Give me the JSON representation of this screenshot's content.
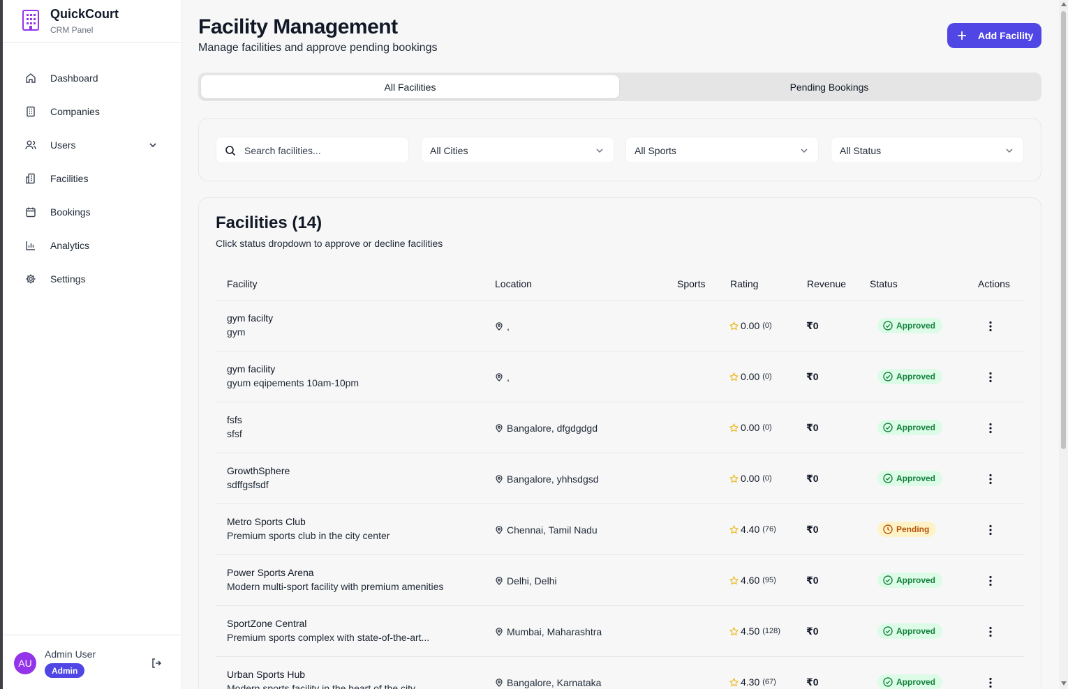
{
  "brand": {
    "name": "QuickCourt",
    "subtitle": "CRM Panel",
    "accent": "#9333ea"
  },
  "sidebar": {
    "items": [
      {
        "label": "Dashboard",
        "icon": "home-icon"
      },
      {
        "label": "Companies",
        "icon": "building-icon"
      },
      {
        "label": "Users",
        "icon": "users-icon",
        "expandable": true
      },
      {
        "label": "Facilities",
        "icon": "facility-icon"
      },
      {
        "label": "Bookings",
        "icon": "calendar-icon"
      },
      {
        "label": "Analytics",
        "icon": "bar-chart-icon"
      },
      {
        "label": "Settings",
        "icon": "gear-icon"
      }
    ]
  },
  "user": {
    "initials": "AU",
    "name": "Admin User",
    "role": "Admin"
  },
  "header": {
    "title": "Facility Management",
    "subtitle": "Manage facilities and approve pending bookings",
    "add_button": "Add Facility",
    "primary_color": "#4f46e5"
  },
  "tabs": [
    {
      "label": "All Facilities",
      "active": true
    },
    {
      "label": "Pending Bookings",
      "active": false
    }
  ],
  "filters": {
    "search_placeholder": "Search facilities...",
    "city": "All Cities",
    "sport": "All Sports",
    "status": "All Status"
  },
  "table": {
    "title": "Facilities (14)",
    "subtitle": "Click status dropdown to approve or decline facilities",
    "columns": [
      "Facility",
      "Location",
      "Sports",
      "Rating",
      "Revenue",
      "Status",
      "Actions"
    ],
    "rows": [
      {
        "name": "gym facilty",
        "desc": "gym",
        "location": ",",
        "rating": "0.00",
        "reviews": "(0)",
        "revenue": "₹0",
        "status": "Approved"
      },
      {
        "name": "gym facility",
        "desc": "gyum eqipements 10am-10pm",
        "location": ",",
        "rating": "0.00",
        "reviews": "(0)",
        "revenue": "₹0",
        "status": "Approved"
      },
      {
        "name": "fsfs",
        "desc": "sfsf",
        "location": "Bangalore, dfgdgdgd",
        "rating": "0.00",
        "reviews": "(0)",
        "revenue": "₹0",
        "status": "Approved"
      },
      {
        "name": "GrowthSphere",
        "desc": "sdffgsfsdf",
        "location": "Bangalore, yhhsdgsd",
        "rating": "0.00",
        "reviews": "(0)",
        "revenue": "₹0",
        "status": "Approved"
      },
      {
        "name": "Metro Sports Club",
        "desc": "Premium sports club in the city center",
        "location": "Chennai, Tamil Nadu",
        "rating": "4.40",
        "reviews": "(76)",
        "revenue": "₹0",
        "status": "Pending"
      },
      {
        "name": "Power Sports Arena",
        "desc": "Modern multi-sport facility with premium amenities",
        "location": "Delhi, Delhi",
        "rating": "4.60",
        "reviews": "(95)",
        "revenue": "₹0",
        "status": "Approved"
      },
      {
        "name": "SportZone Central",
        "desc": "Premium sports complex with state-of-the-art...",
        "location": "Mumbai, Maharashtra",
        "rating": "4.50",
        "reviews": "(128)",
        "revenue": "₹0",
        "status": "Approved"
      },
      {
        "name": "Urban Sports Hub",
        "desc": "Modern sports facility in the heart of the city",
        "location": "Bangalore, Karnataka",
        "rating": "4.30",
        "reviews": "(67)",
        "revenue": "₹0",
        "status": "Approved"
      }
    ]
  },
  "status_colors": {
    "approved": "#15803d",
    "pending": "#b45309",
    "star": "#eab308"
  }
}
